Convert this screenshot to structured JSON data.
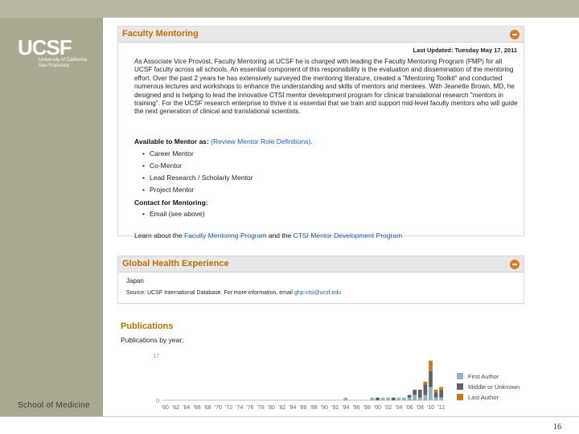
{
  "branding": {
    "logo_mark": "UCSF",
    "logo_line1": "University of California",
    "logo_line2": "San Francisco",
    "school": "School of Medicine",
    "page_number": "16"
  },
  "faculty_mentoring": {
    "title": "Faculty Mentoring",
    "last_updated": "Last Updated: Tuesday May 17, 2011",
    "body": "As Associate Vice Provost, Faculty Mentoring at UCSF he is charged with leading the Faculty Mentoring Program (FMP) for all UCSF faculty across all schools. An essential component of this responsibility is the evaluation and dissemination of the mentoring effort. Over the past 2 years he has extensively surveyed the mentoring literature, created a \"Mentoring Toolkit\" and conducted numerous lectures and workshops to enhance the understanding and skills of mentors and mentees. With Jeanette Brown, MD, he designed and is helping to lead the innovative CTSI mentor development program for clinical translational research \"mentors in training\". For the UCSF research enterprise to thrive it is essential that we train and support mid-level faculty mentors who will guide the next generation of clinical and translational scientists.",
    "available_heading": "Available to Mentor as:",
    "review_link": "(Review Mentor Role Definitions)",
    "available_suffix": ".",
    "roles": [
      "Career Mentor",
      "Co-Mentor",
      "Lead Research / Scholarly Mentor",
      "Project Mentor"
    ],
    "contact_heading": "Contact for Mentoring:",
    "contact_items": [
      "Email (see above)"
    ],
    "learn_prefix": "Learn about the",
    "learn_link1": "Faculty Mentoring Program",
    "learn_mid": "and the",
    "learn_link2": "CTSI Mentor Development Program"
  },
  "global_health": {
    "title": "Global Health Experience",
    "country": "Japan",
    "source_prefix": "Source: UCSF International Database. For more information, email",
    "source_email": "ghp-ctsi@ucsf.edu"
  },
  "publications": {
    "title": "Publications",
    "subtitle": "Publications by year:"
  },
  "chart_data": {
    "type": "bar",
    "title": "",
    "xlabel": "",
    "ylabel": "",
    "ylim": [
      0,
      17
    ],
    "y_ticks": [
      "0",
      "17"
    ],
    "x_tick_labels": [
      "'60",
      "'62",
      "'64",
      "'66",
      "'68",
      "'70",
      "'72",
      "'74",
      "'76",
      "'78",
      "'80",
      "'82",
      "'84",
      "'86",
      "'88",
      "'90",
      "'92",
      "'94",
      "'96",
      "'98",
      "'00",
      "'02",
      "'04",
      "'06",
      "'08",
      "'10",
      "'12"
    ],
    "legend_placement": "right",
    "categories": [
      "'60",
      "'61",
      "'62",
      "'63",
      "'64",
      "'65",
      "'66",
      "'67",
      "'68",
      "'69",
      "'70",
      "'71",
      "'72",
      "'73",
      "'74",
      "'75",
      "'76",
      "'77",
      "'78",
      "'79",
      "'80",
      "'81",
      "'82",
      "'83",
      "'84",
      "'85",
      "'86",
      "'87",
      "'88",
      "'89",
      "'90",
      "'91",
      "'92",
      "'93",
      "'94",
      "'95",
      "'96",
      "'97",
      "'98",
      "'99",
      "'00",
      "'01",
      "'02",
      "'03",
      "'04",
      "'05",
      "'06",
      "'07",
      "'08",
      "'09",
      "'10",
      "'11",
      "'12"
    ],
    "series": [
      {
        "name": "First Author",
        "color": "#8fb6c2",
        "values": [
          0,
          0,
          0,
          0,
          0,
          0,
          0,
          0,
          0,
          0,
          0,
          0,
          0,
          0,
          0,
          0,
          0,
          0,
          0,
          0,
          0,
          0,
          0,
          0,
          0,
          0,
          0,
          0,
          0,
          0,
          0,
          0,
          0,
          0,
          1,
          0,
          0,
          0,
          0,
          1,
          0,
          1,
          1,
          0,
          1,
          1,
          1,
          2,
          1,
          2,
          5,
          1,
          1
        ]
      },
      {
        "name": "Middle or Unknown",
        "color": "#636363",
        "values": [
          0,
          0,
          0,
          0,
          0,
          0,
          0,
          0,
          0,
          0,
          0,
          0,
          0,
          0,
          0,
          0,
          0,
          0,
          0,
          0,
          0,
          0,
          0,
          0,
          0,
          0,
          0,
          0,
          0,
          0,
          0,
          0,
          0,
          0,
          0,
          0,
          0,
          0,
          0,
          0,
          1,
          0,
          0,
          1,
          0,
          0,
          1,
          2,
          3,
          4,
          6,
          2,
          3
        ]
      },
      {
        "name": "Last Author",
        "color": "#c77a1a",
        "values": [
          0,
          0,
          0,
          0,
          0,
          0,
          0,
          0,
          0,
          0,
          0,
          0,
          0,
          0,
          0,
          0,
          0,
          0,
          0,
          0,
          0,
          0,
          0,
          0,
          0,
          0,
          0,
          0,
          0,
          0,
          0,
          0,
          0,
          0,
          0,
          0,
          0,
          0,
          0,
          0,
          0,
          0,
          0,
          0,
          0,
          0,
          0,
          0,
          0,
          1,
          4,
          1,
          1
        ]
      }
    ]
  }
}
